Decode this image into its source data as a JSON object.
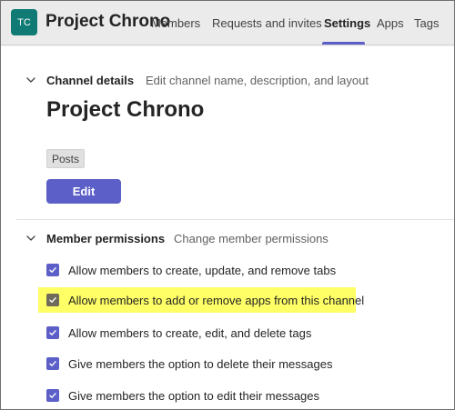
{
  "header": {
    "avatar_initials": "TC",
    "team_name": "Project Chrono",
    "tabs": [
      {
        "label": "Members"
      },
      {
        "label": "Requests and invites"
      },
      {
        "label": "Settings",
        "active": true
      },
      {
        "label": "Apps"
      },
      {
        "label": "Tags"
      }
    ],
    "avatar_color": "#0f7b74",
    "accent_color": "#5b5fc7"
  },
  "channel_details": {
    "title": "Channel details",
    "description": "Edit channel name, description, and layout",
    "channel_name": "Project Chrono",
    "tag": "Posts",
    "edit_label": "Edit",
    "icon": "chevron-down-icon"
  },
  "member_permissions": {
    "title": "Member permissions",
    "description": "Change member permissions",
    "icon": "chevron-down-icon",
    "highlight_color": "#ffff66",
    "items": [
      {
        "label": "Allow members to create, update, and remove tabs",
        "checked": true
      },
      {
        "label": "Allow members to add or remove apps from this channel",
        "checked": true,
        "highlighted": true
      },
      {
        "label": "Allow members to create, edit, and delete tags",
        "checked": true
      },
      {
        "label": "Give members the option to delete their messages",
        "checked": true
      },
      {
        "label": "Give members the option to edit their messages",
        "checked": true
      }
    ]
  }
}
